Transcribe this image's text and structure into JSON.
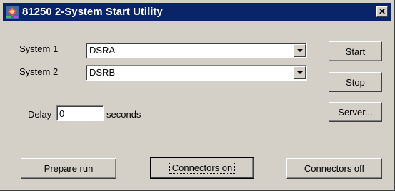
{
  "window": {
    "title": "81250 2-System Start Utility",
    "close_glyph": "✕",
    "icon": "app-icon"
  },
  "form": {
    "system1_label": "System 1",
    "system1_value": "DSRA",
    "system2_label": "System 2",
    "system2_value": "DSRB",
    "delay_label": "Delay",
    "delay_value": "0",
    "delay_unit": "seconds"
  },
  "buttons": {
    "start": "Start",
    "stop": "Stop",
    "server": "Server...",
    "prepare_run": "Prepare run",
    "connectors_on": "Connectors on",
    "connectors_off": "Connectors off"
  },
  "colors": {
    "titlebar": "#0a246a",
    "face": "#d4d0c8"
  }
}
